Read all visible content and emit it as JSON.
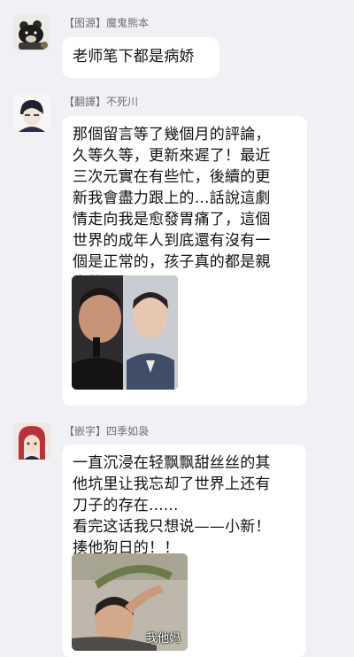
{
  "messages": [
    {
      "sender": "【图源】魔鬼熊本",
      "text": "老师笔下都是病娇"
    },
    {
      "sender": "【翻譯】不死川",
      "text": "那個留言等了幾個月的評論，\n久等久等，更新來遲了！最近\n三次元實在有些忙，後續的更\n新我會盡力跟上的…話說這劇\n情走向我是愈發胃痛了，這個\n世界的成年人到底還有沒有一\n個是正常的，孩子真的都是親\n生的嗎?"
    },
    {
      "sender": "【嵌字】四季如袅",
      "text": "一直沉浸在轻飘飘甜丝丝的其\n他坑里让我忘却了世界上还有\n刀子的存在......\n看完这话我只想说——小新！\n揍他狗日的！！",
      "image_caption": "我他妈"
    }
  ]
}
